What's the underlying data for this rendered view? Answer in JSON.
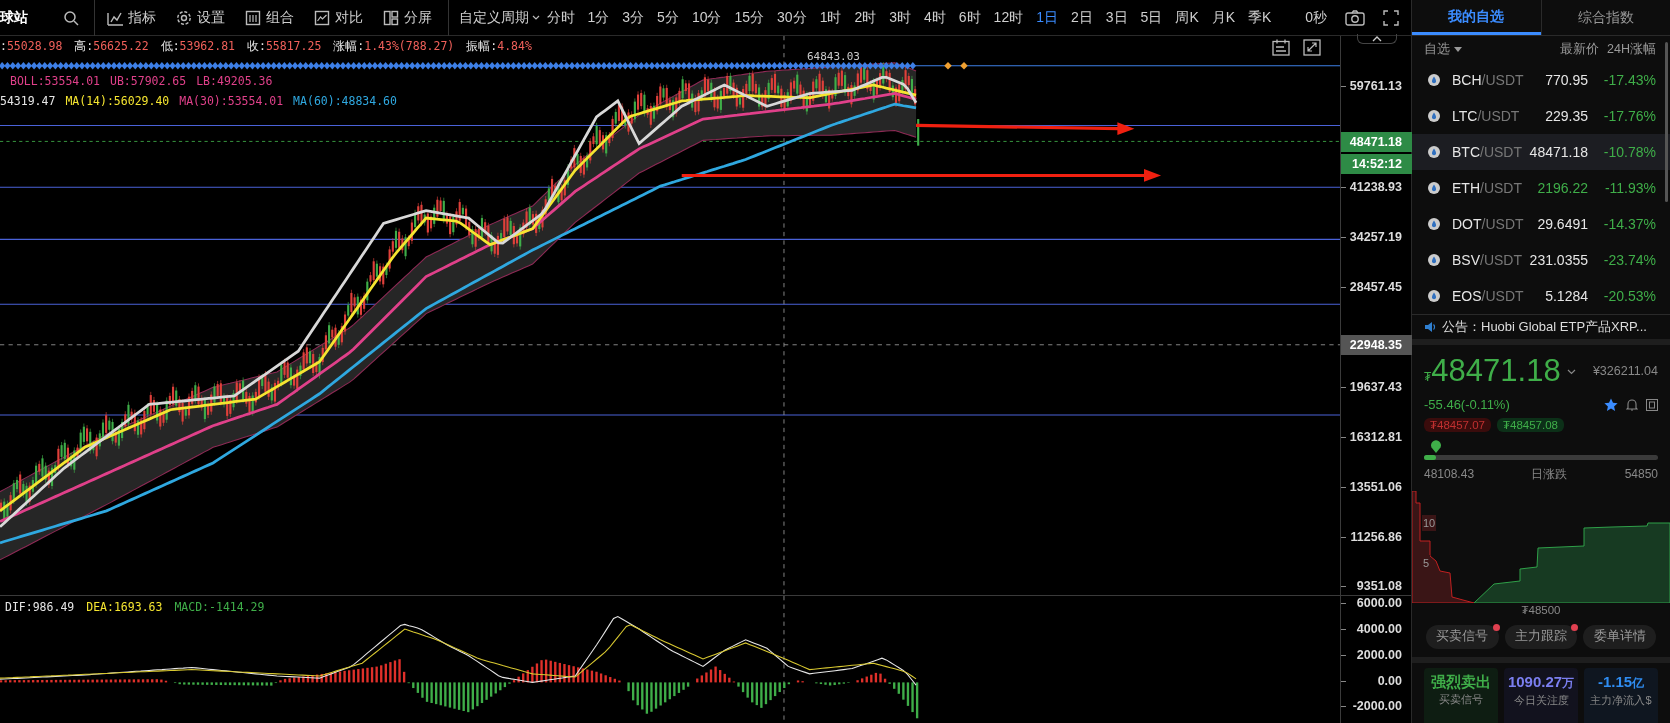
{
  "logo": {
    "text": "球站"
  },
  "toolbar": {
    "tools": [
      {
        "label": "指标",
        "kind": "indicator"
      },
      {
        "label": "设置",
        "kind": "settings"
      },
      {
        "label": "组合",
        "kind": "combo"
      },
      {
        "label": "对比",
        "kind": "compare"
      },
      {
        "label": "分屏",
        "kind": "split"
      }
    ],
    "period_menu": "自定义周期",
    "periods": [
      {
        "label": "分时",
        "selected": false
      },
      {
        "label": "1分",
        "selected": false
      },
      {
        "label": "3分",
        "selected": false
      },
      {
        "label": "5分",
        "selected": false
      },
      {
        "label": "10分",
        "selected": false
      },
      {
        "label": "15分",
        "selected": false
      },
      {
        "label": "30分",
        "selected": false
      },
      {
        "label": "1时",
        "selected": false
      },
      {
        "label": "2时",
        "selected": false
      },
      {
        "label": "3时",
        "selected": false
      },
      {
        "label": "4时",
        "selected": false
      },
      {
        "label": "6时",
        "selected": false
      },
      {
        "label": "12时",
        "selected": false
      },
      {
        "label": "1日",
        "selected": true
      },
      {
        "label": "2日",
        "selected": false
      },
      {
        "label": "3日",
        "selected": false
      },
      {
        "label": "5日",
        "selected": false
      },
      {
        "label": "周K",
        "selected": false
      },
      {
        "label": "月K",
        "selected": false
      },
      {
        "label": "季K",
        "selected": false
      }
    ],
    "timer": "0秒"
  },
  "chart": {
    "ohlc": [
      {
        "label": ":",
        "value": "55028.98"
      },
      {
        "label": "高:",
        "value": "56625.22"
      },
      {
        "label": "低:",
        "value": "53962.81"
      },
      {
        "label": "收:",
        "value": "55817.25"
      },
      {
        "label": "涨幅:",
        "value": "1.43%(788.27)"
      },
      {
        "label": "振幅:",
        "value": "4.84%"
      }
    ],
    "boll": [
      {
        "text": "BOLL:53554.01",
        "color": "#e0408a"
      },
      {
        "text": "UB:57902.65",
        "color": "#e0408a"
      },
      {
        "text": "LB:49205.36",
        "color": "#e0408a"
      }
    ],
    "ma": [
      {
        "text": "54319.47",
        "color": "#e6e6e6"
      },
      {
        "text": "MA(14):56029.40",
        "color": "#f5e530"
      },
      {
        "text": "MA(30):53554.01",
        "color": "#e0408a"
      },
      {
        "text": "MA(60):48834.60",
        "color": "#2fa8e0"
      }
    ],
    "high_mark": "64843.03",
    "price_axis": [
      "59761.13",
      "41238.93",
      "34257.19",
      "28457.45",
      "19637.43",
      "16312.81",
      "13551.06",
      "11256.86",
      "9351.08"
    ],
    "last_price_badge": "48471.18",
    "countdown_badge": "14:52:12",
    "crosshair_badge": "22948.35",
    "macd": {
      "legend": [
        {
          "text": "DIF:986.49",
          "color": "#e6e6e6"
        },
        {
          "text": "DEA:1693.63",
          "color": "#f5e530"
        },
        {
          "text": "MACD:-1414.29",
          "color": "#3fae49"
        }
      ],
      "axis": [
        "6000.00",
        "4000.00",
        "2000.00",
        "0.00",
        "-2000.00"
      ]
    }
  },
  "watchlist": {
    "tabs": [
      {
        "label": "我的自选",
        "selected": true
      },
      {
        "label": "综合指数",
        "selected": false
      }
    ],
    "header": {
      "group": "自选",
      "price": "最新价",
      "change": "24H涨幅"
    },
    "rows": [
      {
        "base": "BCH",
        "quote": "/USDT",
        "price": "770.95",
        "change": "-17.43%",
        "color": "#e6e6e6",
        "selected": false
      },
      {
        "base": "LTC",
        "quote": "/USDT",
        "price": "229.35",
        "change": "-17.76%",
        "color": "#e6e6e6",
        "selected": false
      },
      {
        "base": "BTC",
        "quote": "/USDT",
        "price": "48471.18",
        "change": "-10.78%",
        "color": "#e6e6e6",
        "selected": true
      },
      {
        "base": "ETH",
        "quote": "/USDT",
        "price": "2196.22",
        "change": "-11.93%",
        "color": "#3fae49",
        "selected": false
      },
      {
        "base": "DOT",
        "quote": "/USDT",
        "price": "29.6491",
        "change": "-14.37%",
        "color": "#e6e6e6",
        "selected": false
      },
      {
        "base": "BSV",
        "quote": "/USDT",
        "price": "231.0355",
        "change": "-23.74%",
        "color": "#e6e6e6",
        "selected": false
      },
      {
        "base": "EOS",
        "quote": "/USDT",
        "price": "5.1284",
        "change": "-20.53%",
        "color": "#e6e6e6",
        "selected": false
      }
    ]
  },
  "notice": "公告：Huobi Global ETP产品XRP...",
  "ticker": {
    "currency": "₮",
    "price": "48471.18",
    "cny": "¥326211.04",
    "change": "-55.46(-0.11%)",
    "favorite": true,
    "bid": "₮48457.07",
    "ask": "₮48457.08",
    "range": {
      "level": 0.05,
      "low": "48108.43",
      "label": "日涨跌",
      "high": "54850"
    },
    "depth": {
      "labels": [
        "10",
        "5"
      ],
      "price": "₮48500"
    },
    "buttons": [
      {
        "label": "买卖信号",
        "alert": true
      },
      {
        "label": "主力跟踪",
        "alert": true
      },
      {
        "label": "委单详情",
        "alert": false
      }
    ],
    "stats": [
      {
        "value": "强烈卖出",
        "caption": "买卖信号",
        "color": "#3fae49"
      },
      {
        "value": "1090.27",
        "unit": "万",
        "caption": "今日关注度",
        "color": "#7b7ff0"
      },
      {
        "value": "-1.15",
        "unit": "亿",
        "caption": "主力净流入$",
        "color": "#2f8cf0"
      }
    ]
  }
}
